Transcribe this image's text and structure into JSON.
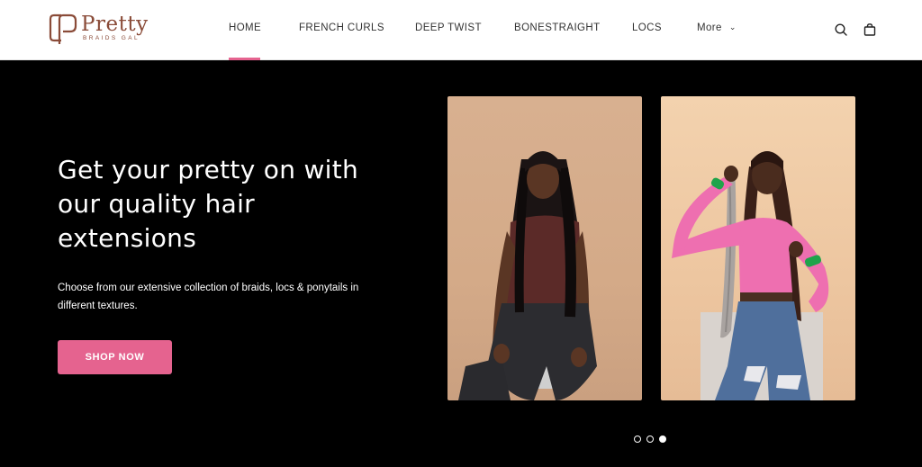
{
  "brand": {
    "name": "Pretty",
    "tagline": "BRAIDS GAL"
  },
  "nav": {
    "items": [
      {
        "label": "HOME"
      },
      {
        "label": "FRENCH CURLS"
      },
      {
        "label": "DEEP TWIST"
      },
      {
        "label": "BONESTRAIGHT"
      },
      {
        "label": "LOCS"
      },
      {
        "label": "More"
      }
    ],
    "active_index": 0
  },
  "icons": {
    "search": "search-icon",
    "cart": "shopping-bag-icon",
    "more": "chevron-down-icon"
  },
  "hero": {
    "title": "Get your pretty on with our quality hair extensions",
    "description": "Choose from our extensive collection of braids, locs & ponytails in different textures.",
    "cta_label": "SHOP NOW"
  },
  "slider": {
    "slide_count": 3,
    "active_slide": 3
  },
  "colors": {
    "accent": "#e5638f",
    "brand": "#8a4b38",
    "hero_bg": "#000000"
  }
}
